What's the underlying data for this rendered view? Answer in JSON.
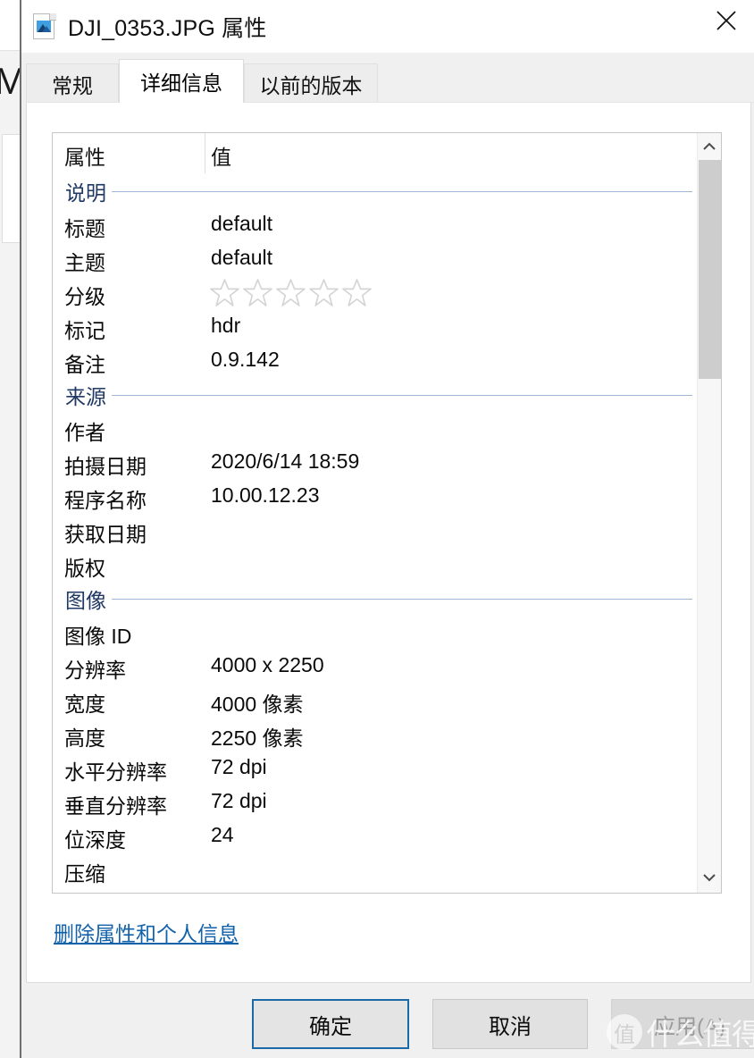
{
  "window": {
    "title": "DJI_0353.JPG 属性",
    "icon": "jpg-file-icon",
    "close_label": "✕"
  },
  "tabs": [
    {
      "label": "常规",
      "active": false
    },
    {
      "label": "详细信息",
      "active": true
    },
    {
      "label": "以前的版本",
      "active": false
    }
  ],
  "list": {
    "columns": {
      "property": "属性",
      "value": "值"
    },
    "sections": [
      {
        "title": "说明",
        "rows": [
          {
            "name": "标题",
            "value": "default"
          },
          {
            "name": "主题",
            "value": "default"
          },
          {
            "name": "分级",
            "value": "",
            "rating": 0,
            "rating_max": 5
          },
          {
            "name": "标记",
            "value": "hdr"
          },
          {
            "name": "备注",
            "value": "0.9.142"
          }
        ]
      },
      {
        "title": "来源",
        "rows": [
          {
            "name": "作者",
            "value": ""
          },
          {
            "name": "拍摄日期",
            "value": "2020/6/14 18:59"
          },
          {
            "name": "程序名称",
            "value": "10.00.12.23"
          },
          {
            "name": "获取日期",
            "value": ""
          },
          {
            "name": "版权",
            "value": ""
          }
        ]
      },
      {
        "title": "图像",
        "rows": [
          {
            "name": "图像 ID",
            "value": ""
          },
          {
            "name": "分辨率",
            "value": "4000 x 2250"
          },
          {
            "name": "宽度",
            "value": "4000 像素"
          },
          {
            "name": "高度",
            "value": "2250 像素"
          },
          {
            "name": "水平分辨率",
            "value": "72 dpi"
          },
          {
            "name": "垂直分辨率",
            "value": "72 dpi"
          },
          {
            "name": "位深度",
            "value": "24"
          },
          {
            "name": "压缩",
            "value": ""
          }
        ]
      }
    ],
    "scroll": {
      "up": "▲",
      "down": "▼",
      "thumb_position_percent": 3
    }
  },
  "remove_link": {
    "label": "删除属性和个人信息"
  },
  "buttons": {
    "ok": "确定",
    "cancel": "取消",
    "apply": "应用(A)"
  },
  "watermark": {
    "logo": "值",
    "text": "什么值得买"
  },
  "colors": {
    "accent": "#1a6aa8",
    "link": "#1262ab",
    "section_header": "#1f3864",
    "section_rule": "#9fb6d4",
    "window_bg": "#f0f0f0",
    "panel_bg": "#ffffff",
    "scroll_thumb": "#cdcdcd"
  }
}
